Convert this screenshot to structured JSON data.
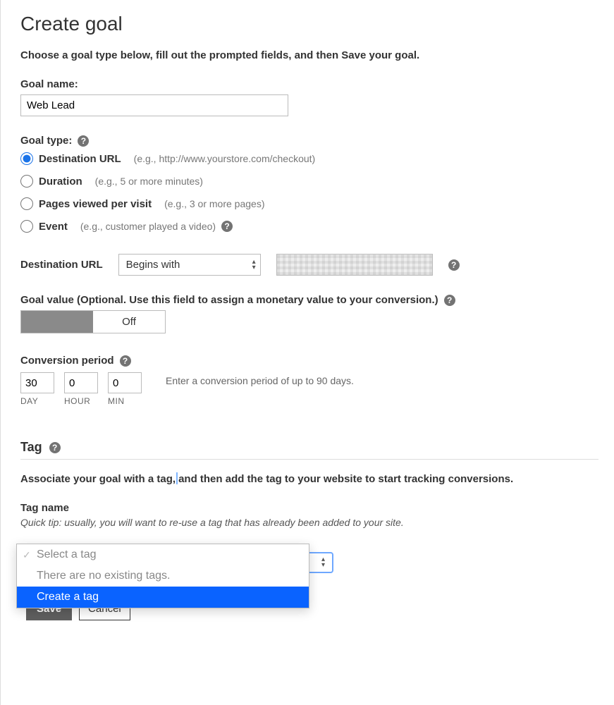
{
  "title": "Create goal",
  "subhead": "Choose a goal type below, fill out the prompted fields, and then Save your goal.",
  "goalName": {
    "label": "Goal name:",
    "value": "Web Lead"
  },
  "goalType": {
    "label": "Goal type:",
    "options": [
      {
        "name": "Destination URL",
        "hint": "(e.g., http://www.yourstore.com/checkout)",
        "selected": true
      },
      {
        "name": "Duration",
        "hint": "(e.g., 5 or more minutes)",
        "selected": false
      },
      {
        "name": "Pages viewed per visit",
        "hint": "(e.g., 3 or more pages)",
        "selected": false
      },
      {
        "name": "Event",
        "hint": "(e.g., customer played a video)",
        "selected": false,
        "help": true
      }
    ]
  },
  "destUrl": {
    "label": "Destination URL",
    "match": "Begins with"
  },
  "goalValue": {
    "label": "Goal value (Optional. Use this field to assign a monetary value to your conversion.)",
    "off": "Off"
  },
  "conversionPeriod": {
    "label": "Conversion period",
    "day": "30",
    "hour": "0",
    "min": "0",
    "units": {
      "day": "DAY",
      "hour": "HOUR",
      "min": "MIN"
    },
    "note": "Enter a conversion period of up to 90 days."
  },
  "tag": {
    "heading": "Tag",
    "assoc_a": "Associate your goal with a tag,",
    "assoc_b": "and then add the tag to your website to start tracking conversions.",
    "name_label": "Tag name",
    "tip": "Quick tip: usually, you will want to re-use a tag that has already been added to your site.",
    "dropdown": {
      "placeholder": "Select a tag",
      "empty": "There are no existing tags.",
      "create": "Create a tag"
    }
  },
  "buttons": {
    "save": "Save",
    "cancel": "Cancel"
  }
}
